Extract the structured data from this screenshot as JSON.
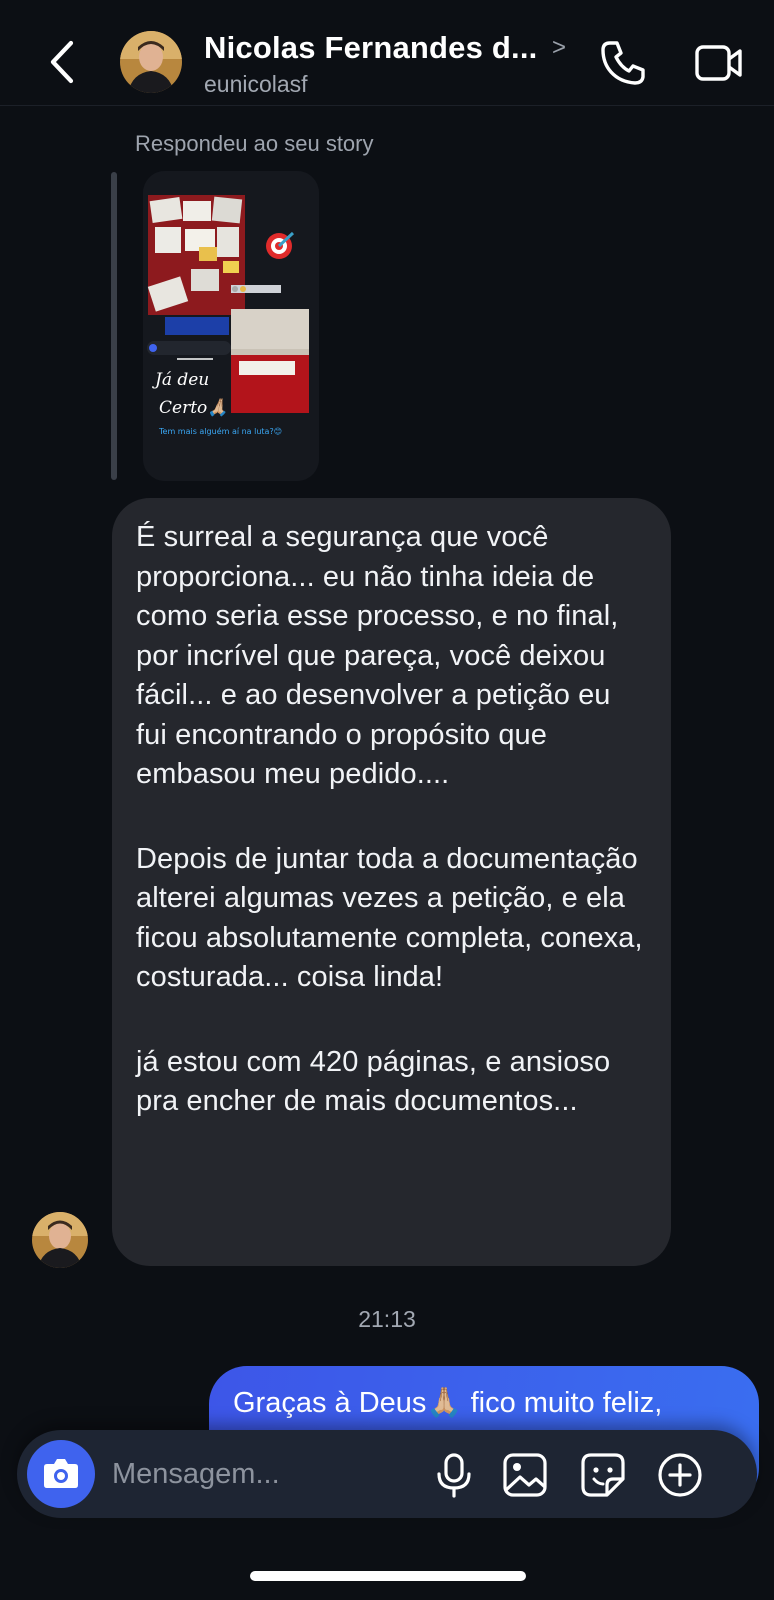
{
  "header": {
    "title": "Nicolas Fernandes d...",
    "username": "eunicolasf",
    "chevron": ">",
    "icons": {
      "back": "chevron-left-icon",
      "call": "phone-icon",
      "video": "video-camera-icon"
    }
  },
  "story": {
    "caption": "Respondeu ao seu story",
    "thumb_text_line1": "Já deu",
    "thumb_text_line2": "Certo🙏🏼",
    "thumb_subtext": "Tem mais alguém aí na luta?😊"
  },
  "received_message": {
    "paragraphs": [
      "É surreal a segurança que você proporciona... eu não tinha ideia de como seria esse processo, e no final, por incrível que pareça, você deixou fácil... e ao desenvolver a petição eu fui encontrando o propósito que embasou meu pedido....",
      "Depois de juntar toda a documentação alterei algumas vezes a petição, e ela ficou absolutamente completa, conexa, costurada... coisa linda!",
      "já estou com 420 páginas, e ansioso pra encher de mais documentos..."
    ]
  },
  "timestamp": "21:13",
  "sent_message": {
    "text": "Graças à Deus🙏🏼 fico muito feliz,"
  },
  "composer": {
    "placeholder": "Mensagem...",
    "icons": [
      "camera-icon",
      "microphone-icon",
      "image-icon",
      "sticker-icon",
      "plus-circle-icon"
    ]
  },
  "colors": {
    "background": "#0c0f14",
    "incoming_bubble": "#25272d",
    "outgoing_bubble": "#3d5ee9",
    "composer": "#1e2533",
    "camera_button": "#3f63ee"
  }
}
